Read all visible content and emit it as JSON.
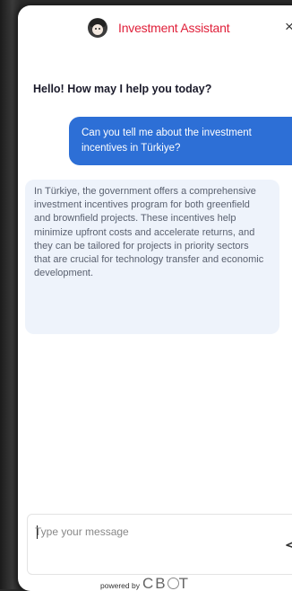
{
  "header": {
    "title": "Investment Assistant",
    "avatar_icon": "assistant-avatar-icon",
    "close_icon": "close-icon",
    "close_label": "×"
  },
  "chat": {
    "greeting": "Hello! How may I help you today?",
    "user_message": "Can you tell me about the investment incentives in Türkiye?",
    "bot_message": "In Türkiye, the government offers a comprehensive investment incentives program for both greenfield and brownfield projects. These incentives help minimize upfront costs and accelerate returns, and they can be tailored for projects in priority sectors that are crucial for technology transfer and economic development."
  },
  "composer": {
    "placeholder": "Type your message",
    "value": "",
    "send_icon": "send-icon"
  },
  "footer": {
    "powered_label": "powered by",
    "brand_c": "C",
    "brand_b": "B",
    "brand_t": "T"
  },
  "colors": {
    "accent": "#2d6fd6",
    "title": "#e0203a",
    "bot_bubble": "#eef3fb"
  }
}
